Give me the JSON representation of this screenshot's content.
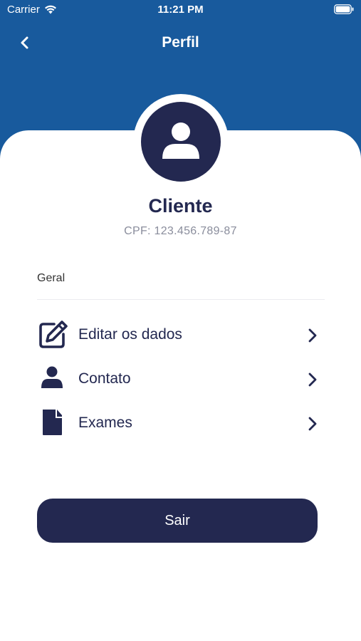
{
  "status_bar": {
    "carrier": "Carrier",
    "time": "11:21 PM"
  },
  "nav": {
    "title": "Perfil"
  },
  "profile": {
    "name": "Cliente",
    "cpf": "CPF: 123.456.789-87"
  },
  "section": {
    "label": "Geral"
  },
  "menu": [
    {
      "label": "Editar os dados",
      "icon": "edit-icon"
    },
    {
      "label": "Contato",
      "icon": "person-icon"
    },
    {
      "label": "Exames",
      "icon": "document-icon"
    }
  ],
  "logout": {
    "label": "Sair"
  },
  "colors": {
    "header": "#185a9d",
    "navy": "#232850",
    "muted": "#8a8d9c"
  }
}
